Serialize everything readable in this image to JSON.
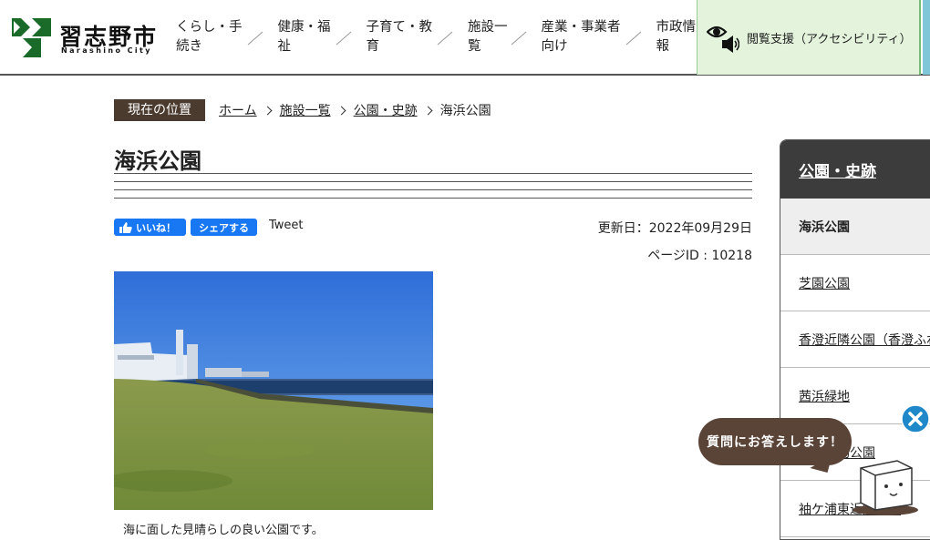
{
  "header": {
    "logo_text": "習志野市",
    "logo_sub": "Narashino City",
    "nav": [
      {
        "label": "くらし・手続き",
        "l1": "くらし・手",
        "l2": "続き"
      },
      {
        "label": "健康・福祉",
        "l1": "健康・福",
        "l2": "祉"
      },
      {
        "label": "子育て・教育",
        "l1": "子育て・教",
        "l2": "育"
      },
      {
        "label": "施設一覧",
        "l1": "施設一",
        "l2": "覧"
      },
      {
        "label": "産業・事業者向け",
        "l1": "産業・事業者",
        "l2": "向け"
      },
      {
        "label": "市政情報",
        "l1": "市政情",
        "l2": "報"
      }
    ],
    "accessibility_label": "閲覧支援（アクセシビリティ）"
  },
  "breadcrumb": {
    "label": "現在の位置",
    "items": [
      "ホーム",
      "施設一覧",
      "公園・史跡"
    ],
    "current": "海浜公園"
  },
  "page": {
    "title": "海浜公園",
    "fb_like": "いいね！",
    "fb_share": "シェアする",
    "tweet": "Tweet",
    "updated": "更新日：2022年09月29日",
    "page_id": "ページID : 10218",
    "caption": "海に面した見晴らしの良い公園です。"
  },
  "side_menu": {
    "heading": "公園・史跡",
    "items": [
      "海浜公園",
      "芝園公園",
      "香澄近隣公園（香澄ふれあい公園）",
      "茜浜緑地",
      "谷津運動公園",
      "袖ケ浦東近隣公園"
    ]
  },
  "chat": {
    "bubble": "質問にお答えします！"
  },
  "colors": {
    "brand_green": "#1a6b2a",
    "breadcrumb_bg": "#4b3b2f",
    "side_head_bg": "#3c3c3c",
    "access_bg": "#e3f3dc",
    "fb_blue": "#1877f2",
    "chat_bg": "#5a4437",
    "close_blue": "#1e88c8"
  }
}
